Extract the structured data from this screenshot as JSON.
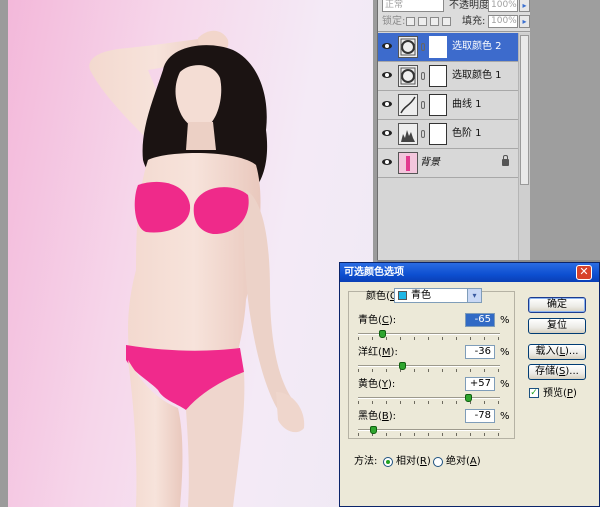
{
  "layers_panel": {
    "blend_mode": "正常",
    "opacity_label": "不透明度:",
    "opacity_value": "100%",
    "lock_label": "锁定:",
    "fill_label": "填充:",
    "fill_value": "100%",
    "layers": [
      {
        "name": "选取颜色 2",
        "type": "selective-color-adjustment",
        "active": true
      },
      {
        "name": "选取颜色 1",
        "type": "selective-color-adjustment",
        "active": false
      },
      {
        "name": "曲线 1",
        "type": "curves-adjustment",
        "active": false
      },
      {
        "name": "色阶 1",
        "type": "levels-adjustment",
        "active": false
      },
      {
        "name": "背景",
        "type": "background",
        "active": false,
        "locked": true
      }
    ]
  },
  "dialog": {
    "title": "可选颜色选项",
    "colors_label": "颜色(",
    "colors_key": "O",
    "colors_suffix": "):",
    "selected_color": "青色",
    "selected_color_hex": "#1eb6e6",
    "sliders": [
      {
        "label": "青色(",
        "key": "C",
        "suffix": "):",
        "value": "-65",
        "fraction": 0.175,
        "selected": true
      },
      {
        "label": "洋红(",
        "key": "M",
        "suffix": "):",
        "value": "-36",
        "fraction": 0.32,
        "selected": false
      },
      {
        "label": "黄色(",
        "key": "Y",
        "suffix": "):",
        "value": "+57",
        "fraction": 0.785,
        "selected": false
      },
      {
        "label": "黑色(",
        "key": "B",
        "suffix": "):",
        "value": "-78",
        "fraction": 0.11,
        "selected": false
      }
    ],
    "percent_sign": "%",
    "buttons": {
      "ok": "确定",
      "reset": "复位",
      "load_prefix": "载入(",
      "load_key": "L",
      "load_suffix": ")...",
      "save_prefix": "存储(",
      "save_key": "S",
      "save_suffix": ")..."
    },
    "preview_prefix": "预览(",
    "preview_key": "P",
    "preview_suffix": ")",
    "preview_checked": true,
    "method_label": "方法:",
    "method_relative_prefix": "相对(",
    "method_relative_key": "R",
    "method_relative_suffix": ")",
    "method_absolute_prefix": "绝对(",
    "method_absolute_key": "A",
    "method_absolute_suffix": ")",
    "method_selected": "relative"
  }
}
